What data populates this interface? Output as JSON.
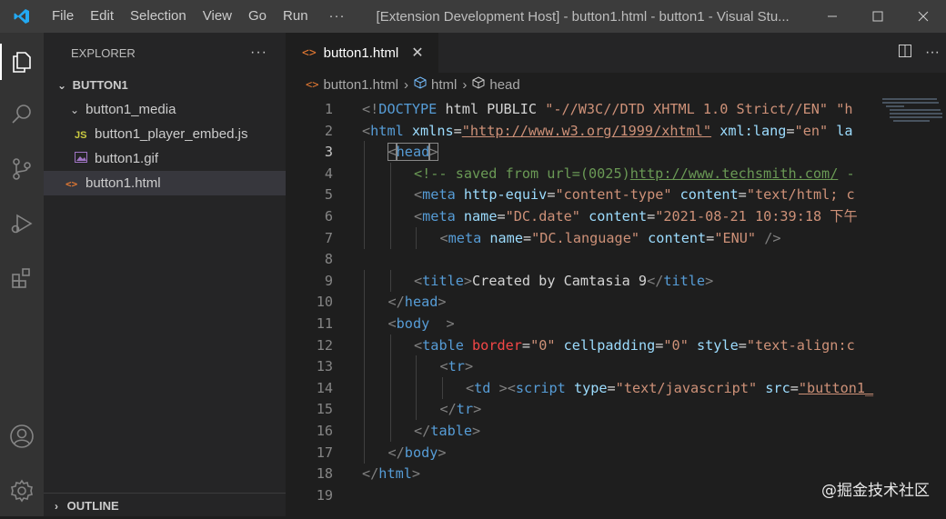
{
  "menu": [
    "File",
    "Edit",
    "Selection",
    "View",
    "Go",
    "Run",
    "···"
  ],
  "window_title": "[Extension Development Host] - button1.html - button1 - Visual Stu...",
  "explorer": {
    "title": "EXPLORER",
    "more": "···",
    "root": "BUTTON1",
    "tree": [
      {
        "label": "button1_media",
        "kind": "folder",
        "icon": ""
      },
      {
        "label": "button1_player_embed.js",
        "kind": "file",
        "icon": "JS"
      },
      {
        "label": "button1.gif",
        "kind": "file",
        "icon": ""
      },
      {
        "label": "button1.html",
        "kind": "file",
        "icon": "<>"
      }
    ],
    "outline": "OUTLINE"
  },
  "tab": {
    "icon": "<>",
    "label": "button1.html",
    "close": "✕"
  },
  "breadcrumb": [
    "button1.html",
    "html",
    "head"
  ],
  "current_line": 3,
  "code_lines": [
    {
      "n": "1",
      "indent": 0,
      "toks": [
        [
          "b",
          "<!"
        ],
        [
          "tag",
          "DOCTYPE"
        ],
        [
          "txt",
          " html PUBLIC "
        ],
        [
          "str",
          "\"-//W3C//DTD XHTML 1.0 Strict//EN\""
        ],
        [
          "txt",
          " "
        ],
        [
          "str",
          "\"h"
        ]
      ]
    },
    {
      "n": "2",
      "indent": 0,
      "toks": [
        [
          "b",
          "<"
        ],
        [
          "tag",
          "html"
        ],
        [
          "txt",
          " "
        ],
        [
          "attr",
          "xmlns"
        ],
        [
          "txt",
          "="
        ],
        [
          "strurl",
          "\"http://www.w3.org/1999/xhtml\""
        ],
        [
          "txt",
          " "
        ],
        [
          "attr",
          "xml:lang"
        ],
        [
          "txt",
          "="
        ],
        [
          "str",
          "\"en\""
        ],
        [
          "txt",
          " "
        ],
        [
          "attr",
          "la"
        ]
      ]
    },
    {
      "n": "3",
      "indent": 1,
      "toks": [
        [
          "bhl",
          "<"
        ],
        [
          "taghl",
          "head"
        ],
        [
          "bhl",
          ">"
        ]
      ]
    },
    {
      "n": "4",
      "indent": 2,
      "toks": [
        [
          "com",
          "<!-- saved from url=(0025)"
        ],
        [
          "comurl",
          "http://www.techsmith.com/"
        ],
        [
          "com",
          " -"
        ]
      ]
    },
    {
      "n": "5",
      "indent": 2,
      "toks": [
        [
          "b",
          "<"
        ],
        [
          "tag",
          "meta"
        ],
        [
          "txt",
          " "
        ],
        [
          "attr",
          "http-equiv"
        ],
        [
          "txt",
          "="
        ],
        [
          "str",
          "\"content-type\""
        ],
        [
          "txt",
          " "
        ],
        [
          "attr",
          "content"
        ],
        [
          "txt",
          "="
        ],
        [
          "str",
          "\"text/html; c"
        ]
      ]
    },
    {
      "n": "6",
      "indent": 2,
      "toks": [
        [
          "b",
          "<"
        ],
        [
          "tag",
          "meta"
        ],
        [
          "txt",
          " "
        ],
        [
          "attr",
          "name"
        ],
        [
          "txt",
          "="
        ],
        [
          "str",
          "\"DC.date\""
        ],
        [
          "txt",
          " "
        ],
        [
          "attr",
          "content"
        ],
        [
          "txt",
          "="
        ],
        [
          "str",
          "\"2021-08-21 10:39:18 下午"
        ]
      ]
    },
    {
      "n": "7",
      "indent": 3,
      "toks": [
        [
          "b",
          "<"
        ],
        [
          "tag",
          "meta"
        ],
        [
          "txt",
          " "
        ],
        [
          "attr",
          "name"
        ],
        [
          "txt",
          "="
        ],
        [
          "str",
          "\"DC.language\""
        ],
        [
          "txt",
          " "
        ],
        [
          "attr",
          "content"
        ],
        [
          "txt",
          "="
        ],
        [
          "str",
          "\"ENU\""
        ],
        [
          "txt",
          " "
        ],
        [
          "b",
          "/>"
        ]
      ]
    },
    {
      "n": "8",
      "indent": 0,
      "toks": []
    },
    {
      "n": "9",
      "indent": 2,
      "toks": [
        [
          "b",
          "<"
        ],
        [
          "tag",
          "title"
        ],
        [
          "b",
          ">"
        ],
        [
          "txt",
          "Created by Camtasia 9"
        ],
        [
          "b",
          "</"
        ],
        [
          "tag",
          "title"
        ],
        [
          "b",
          ">"
        ]
      ]
    },
    {
      "n": "10",
      "indent": 1,
      "toks": [
        [
          "b",
          "</"
        ],
        [
          "tag",
          "head"
        ],
        [
          "b",
          ">"
        ]
      ]
    },
    {
      "n": "11",
      "indent": 1,
      "toks": [
        [
          "b",
          "<"
        ],
        [
          "tag",
          "body"
        ],
        [
          "txt",
          "  "
        ],
        [
          "b",
          ">"
        ]
      ]
    },
    {
      "n": "12",
      "indent": 2,
      "toks": [
        [
          "b",
          "<"
        ],
        [
          "tag",
          "table"
        ],
        [
          "txt",
          " "
        ],
        [
          "err",
          "border"
        ],
        [
          "txt",
          "="
        ],
        [
          "str",
          "\"0\""
        ],
        [
          "txt",
          " "
        ],
        [
          "attr",
          "cellpadding"
        ],
        [
          "txt",
          "="
        ],
        [
          "str",
          "\"0\""
        ],
        [
          "txt",
          " "
        ],
        [
          "attr",
          "style"
        ],
        [
          "txt",
          "="
        ],
        [
          "str",
          "\"text-align:c"
        ]
      ]
    },
    {
      "n": "13",
      "indent": 3,
      "toks": [
        [
          "b",
          "<"
        ],
        [
          "tag",
          "tr"
        ],
        [
          "b",
          ">"
        ]
      ]
    },
    {
      "n": "14",
      "indent": 4,
      "toks": [
        [
          "b",
          "<"
        ],
        [
          "tag",
          "td"
        ],
        [
          "txt",
          " "
        ],
        [
          "b",
          "><"
        ],
        [
          "tag",
          "script"
        ],
        [
          "txt",
          " "
        ],
        [
          "attr",
          "type"
        ],
        [
          "txt",
          "="
        ],
        [
          "str",
          "\"text/javascript\""
        ],
        [
          "txt",
          " "
        ],
        [
          "attr",
          "src"
        ],
        [
          "txt",
          "="
        ],
        [
          "strurl",
          "\"button1_"
        ]
      ]
    },
    {
      "n": "15",
      "indent": 3,
      "toks": [
        [
          "b",
          "</"
        ],
        [
          "tag",
          "tr"
        ],
        [
          "b",
          ">"
        ]
      ]
    },
    {
      "n": "16",
      "indent": 2,
      "toks": [
        [
          "b",
          "</"
        ],
        [
          "tag",
          "table"
        ],
        [
          "b",
          ">"
        ]
      ]
    },
    {
      "n": "17",
      "indent": 1,
      "toks": [
        [
          "b",
          "</"
        ],
        [
          "tag",
          "body"
        ],
        [
          "b",
          ">"
        ]
      ]
    },
    {
      "n": "18",
      "indent": 0,
      "toks": [
        [
          "b",
          "</"
        ],
        [
          "tag",
          "html"
        ],
        [
          "b",
          ">"
        ]
      ]
    },
    {
      "n": "19",
      "indent": 0,
      "toks": []
    }
  ],
  "watermark": "@掘金技术社区",
  "colors": {
    "accent": "#007acc",
    "tag": "#569cd6",
    "attr": "#9cdcfe",
    "string": "#ce9178",
    "comment": "#6a9955"
  }
}
